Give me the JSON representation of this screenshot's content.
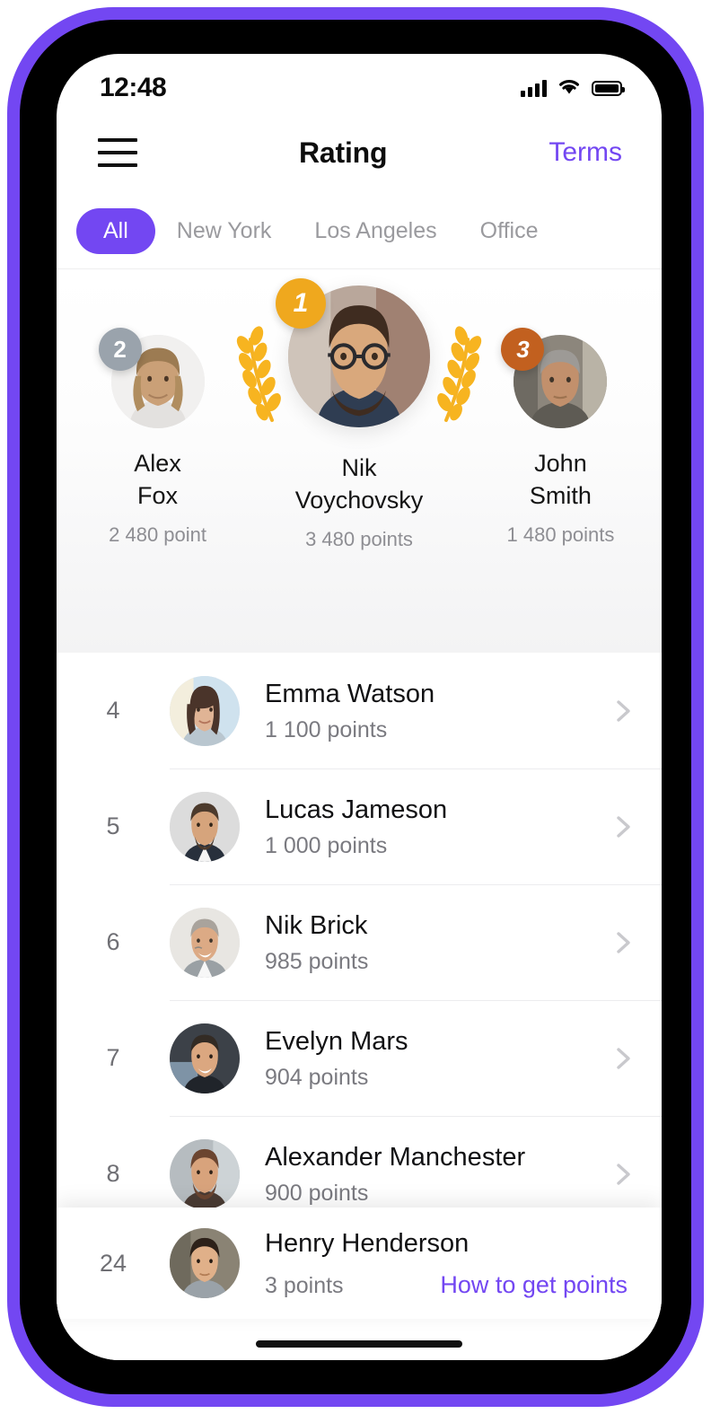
{
  "status_bar": {
    "time": "12:48",
    "signal_icon": "cellular-signal-icon",
    "wifi_icon": "wifi-icon",
    "battery_icon": "battery-full-icon"
  },
  "nav": {
    "menu_icon": "hamburger-menu-icon",
    "title": "Rating",
    "action_label": "Terms"
  },
  "tabs": [
    {
      "label": "All",
      "active": true
    },
    {
      "label": "New York",
      "active": false
    },
    {
      "label": "Los Angeles",
      "active": false
    },
    {
      "label": "Office",
      "active": false
    }
  ],
  "podium": [
    {
      "rank": "2",
      "first_name": "Alex",
      "last_name": "Fox",
      "points": "2 480 point",
      "badge_color": "#9AA3AC"
    },
    {
      "rank": "1",
      "first_name": "Nik",
      "last_name": "Voychovsky",
      "points": "3 480 points",
      "badge_color": "#EFA81E"
    },
    {
      "rank": "3",
      "first_name": "John",
      "last_name": "Smith",
      "points": "1 480 points",
      "badge_color": "#C2601F"
    }
  ],
  "list": [
    {
      "rank": "4",
      "name": "Emma Watson",
      "points": "1 100 points"
    },
    {
      "rank": "5",
      "name": "Lucas Jameson",
      "points": "1 000 points"
    },
    {
      "rank": "6",
      "name": "Nik Brick",
      "points": "985 points"
    },
    {
      "rank": "7",
      "name": "Evelyn Mars",
      "points": "904 points"
    },
    {
      "rank": "8",
      "name": "Alexander Manchester",
      "points": "900 points"
    }
  ],
  "pinned": {
    "rank": "24",
    "name": "Henry Henderson",
    "points": "3 points",
    "link_label": "How to get points"
  },
  "colors": {
    "accent": "#7347F2",
    "gold": "#EFA81E",
    "silver": "#9AA3AC",
    "bronze": "#C2601F",
    "muted": "#8e8e93"
  }
}
